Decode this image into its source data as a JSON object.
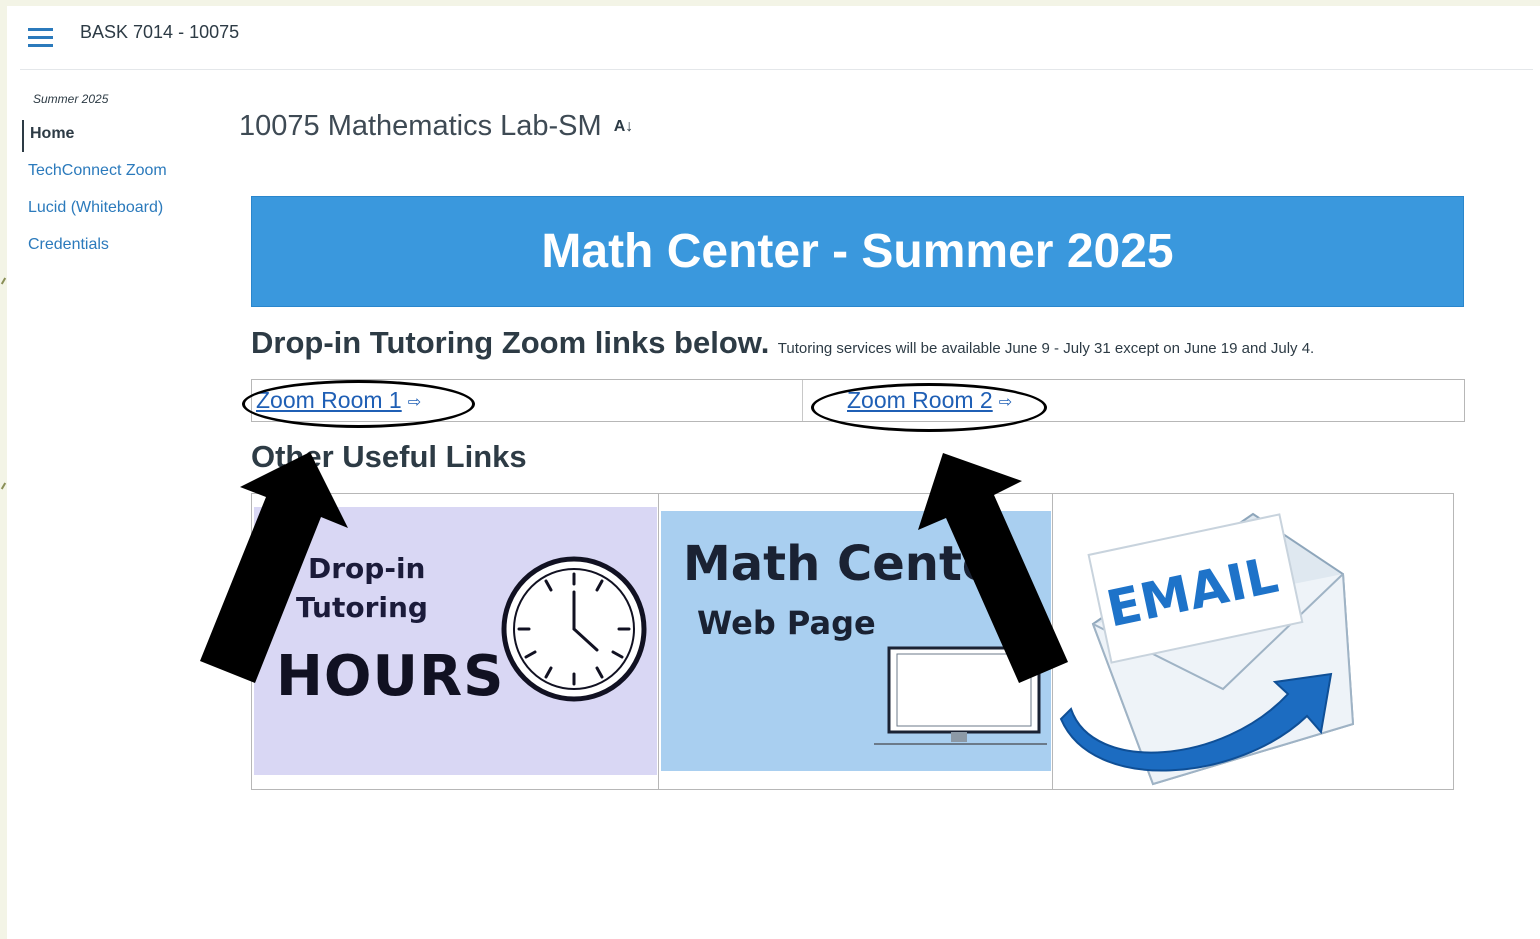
{
  "header": {
    "menu_icon": "hamburger-icon",
    "breadcrumb": "BASK 7014 - 10075",
    "accent_color": "#2b7abc"
  },
  "sidebar": {
    "term": "Summer 2025",
    "items": [
      {
        "label": "Home",
        "active": true
      },
      {
        "label": "TechConnect Zoom",
        "active": false
      },
      {
        "label": "Lucid (Whiteboard)",
        "active": false
      },
      {
        "label": "Credentials",
        "active": false
      }
    ]
  },
  "main": {
    "title": "10075 Mathematics Lab-SM",
    "title_icon": "immersive-reader-icon",
    "banner": {
      "text": "Math Center - Summer 2025",
      "color": "#3a98dd"
    },
    "dropin": {
      "heading": "Drop-in Tutoring Zoom links below.",
      "note": "Tutoring services will be available June 9 - July 31 except on June 19 and July 4."
    },
    "zoom_links": [
      {
        "label": "Zoom Room 1",
        "icon": "external-link-icon"
      },
      {
        "label": "Zoom Room 2",
        "icon": "external-link-icon"
      }
    ],
    "other_links_heading": "Other Useful Links",
    "tiles": {
      "hours": {
        "line1": "Drop-in",
        "line2": "Tutoring",
        "line3": "HOURS",
        "icon": "clock-icon",
        "bg_color": "#d9d7f4"
      },
      "web_page": {
        "line1": "Math Cente",
        "line2": "Web Page",
        "icon": "monitor-icon",
        "bg_color": "#a9cff0"
      },
      "email": {
        "text": "EMAIL",
        "icon": "envelope-icon"
      }
    }
  },
  "annotations": {
    "highlight_color": "#000000",
    "marks": [
      "ellipse-zoom-room-1",
      "ellipse-zoom-room-2",
      "arrow-left",
      "arrow-right"
    ]
  }
}
